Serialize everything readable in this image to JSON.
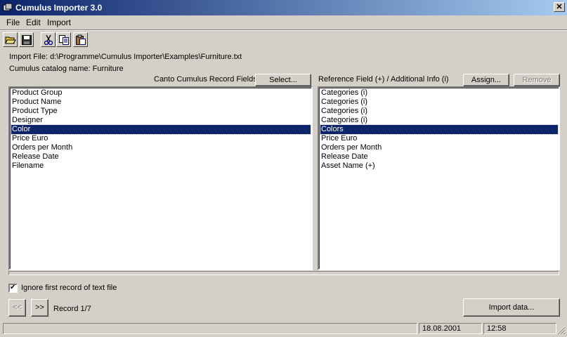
{
  "window": {
    "title": "Cumulus Importer 3.0",
    "close_glyph": "✕"
  },
  "menu": [
    "File",
    "Edit",
    "Import"
  ],
  "toolbar": {
    "icons": [
      "open-folder-icon",
      "save-icon",
      "cut-icon",
      "copy-icon",
      "paste-icon"
    ]
  },
  "info": {
    "import_file": "Import File: d:\\Programme\\Cumulus Importer\\Examples\\Furniture.txt",
    "catalog": "Cumulus catalog name: Furniture"
  },
  "left_panel": {
    "header": "Canto Cumulus Record Fields",
    "select_label": "Select...",
    "selected_index": 4,
    "items": [
      "Product Group",
      "Product Name",
      "Product Type",
      "Designer",
      "Color",
      "Price Euro",
      "Orders per Month",
      "Release Date",
      "Filename"
    ]
  },
  "right_panel": {
    "header": "Reference Field (+) / Additional Info (i)",
    "assign_label": "Assign...",
    "remove_label": "Remove",
    "selected_index": 4,
    "items": [
      "Categories (i)",
      "Categories (i)",
      "Categories (i)",
      "Categories (i)",
      "Colors",
      "Price Euro",
      "Orders per Month",
      "Release Date",
      "Asset Name (+)"
    ]
  },
  "options": {
    "ignore_first_record": "Ignore first record of text file",
    "ignore_checked": true,
    "check_glyph": "✔"
  },
  "navigation": {
    "prev_label": "<<",
    "next_label": ">>",
    "record": "Record 1/7"
  },
  "import_button": "Import data...",
  "status": {
    "date": "18.08.2001",
    "time": "12:58"
  }
}
